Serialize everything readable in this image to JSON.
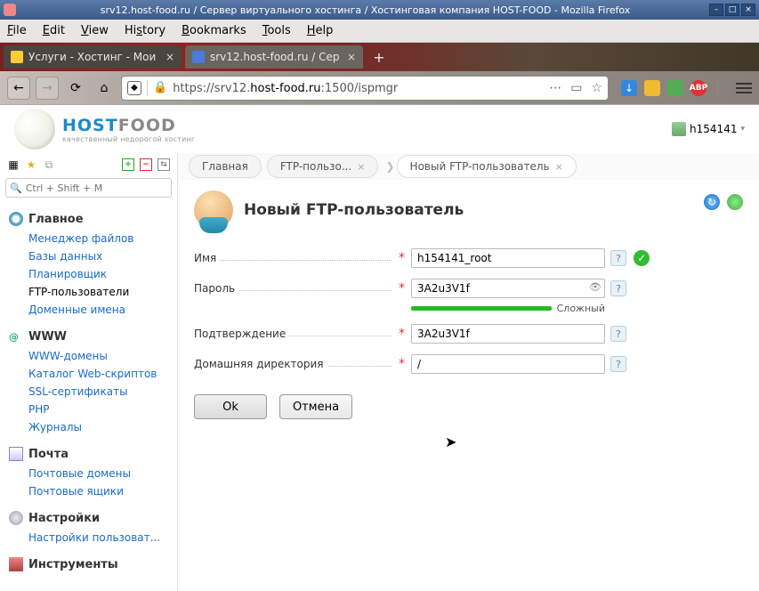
{
  "window": {
    "title": "srv12.host-food.ru / Сервер виртуального хостинга / Хостинговая компания HOST-FOOD - Mozilla Firefox",
    "buttons": {
      "min": "–",
      "max": "□",
      "close": "×"
    }
  },
  "menu": {
    "file": "File",
    "edit": "Edit",
    "view": "View",
    "history": "History",
    "bookmarks": "Bookmarks",
    "tools": "Tools",
    "help": "Help"
  },
  "tabs": {
    "t1": "Услуги - Хостинг - Мои",
    "t2": "srv12.host-food.ru / Сер",
    "close": "×",
    "new": "+"
  },
  "url": {
    "scheme": "https://",
    "sub": "srv12.",
    "domain": "host-food.ru",
    "port": ":1500",
    "path": "/ispmgr",
    "abp": "ABP"
  },
  "logo": {
    "brand_h": "HOST",
    "brand_f": "FOOD",
    "tagline": "качественный недорогой хостинг"
  },
  "user": {
    "name": "h154141"
  },
  "sidebar": {
    "search_ph": "Ctrl + Shift + M",
    "main": {
      "title": "Главное",
      "items": [
        "Менеджер файлов",
        "Базы данных",
        "Планировщик",
        "FTP-пользователи",
        "Доменные имена"
      ]
    },
    "www": {
      "title": "WWW",
      "items": [
        "WWW-домены",
        "Каталог Web-скриптов",
        "SSL-сертификаты",
        "PHP",
        "Журналы"
      ]
    },
    "mail": {
      "title": "Почта",
      "items": [
        "Почтовые домены",
        "Почтовые ящики"
      ]
    },
    "settings": {
      "title": "Настройки",
      "items": [
        "Настройки пользоват..."
      ]
    },
    "tools": {
      "title": "Инструменты"
    }
  },
  "crumbs": {
    "c1": "Главная",
    "c2": "FTP-пользо...",
    "c3": "Новый FTP-пользователь",
    "x": "×",
    "sep": "❯"
  },
  "form": {
    "heading": "Новый FTP-пользователь",
    "name_label": "Имя",
    "name_value": "h154141_root",
    "pass_label": "Пароль",
    "pass_value": "3A2u3V1f",
    "pass_strength": "Сложный",
    "confirm_label": "Подтверждение",
    "confirm_value": "3A2u3V1f",
    "home_label": "Домашняя директория",
    "home_value": "/",
    "help": "?",
    "ok": "Ok",
    "cancel": "Отмена"
  }
}
